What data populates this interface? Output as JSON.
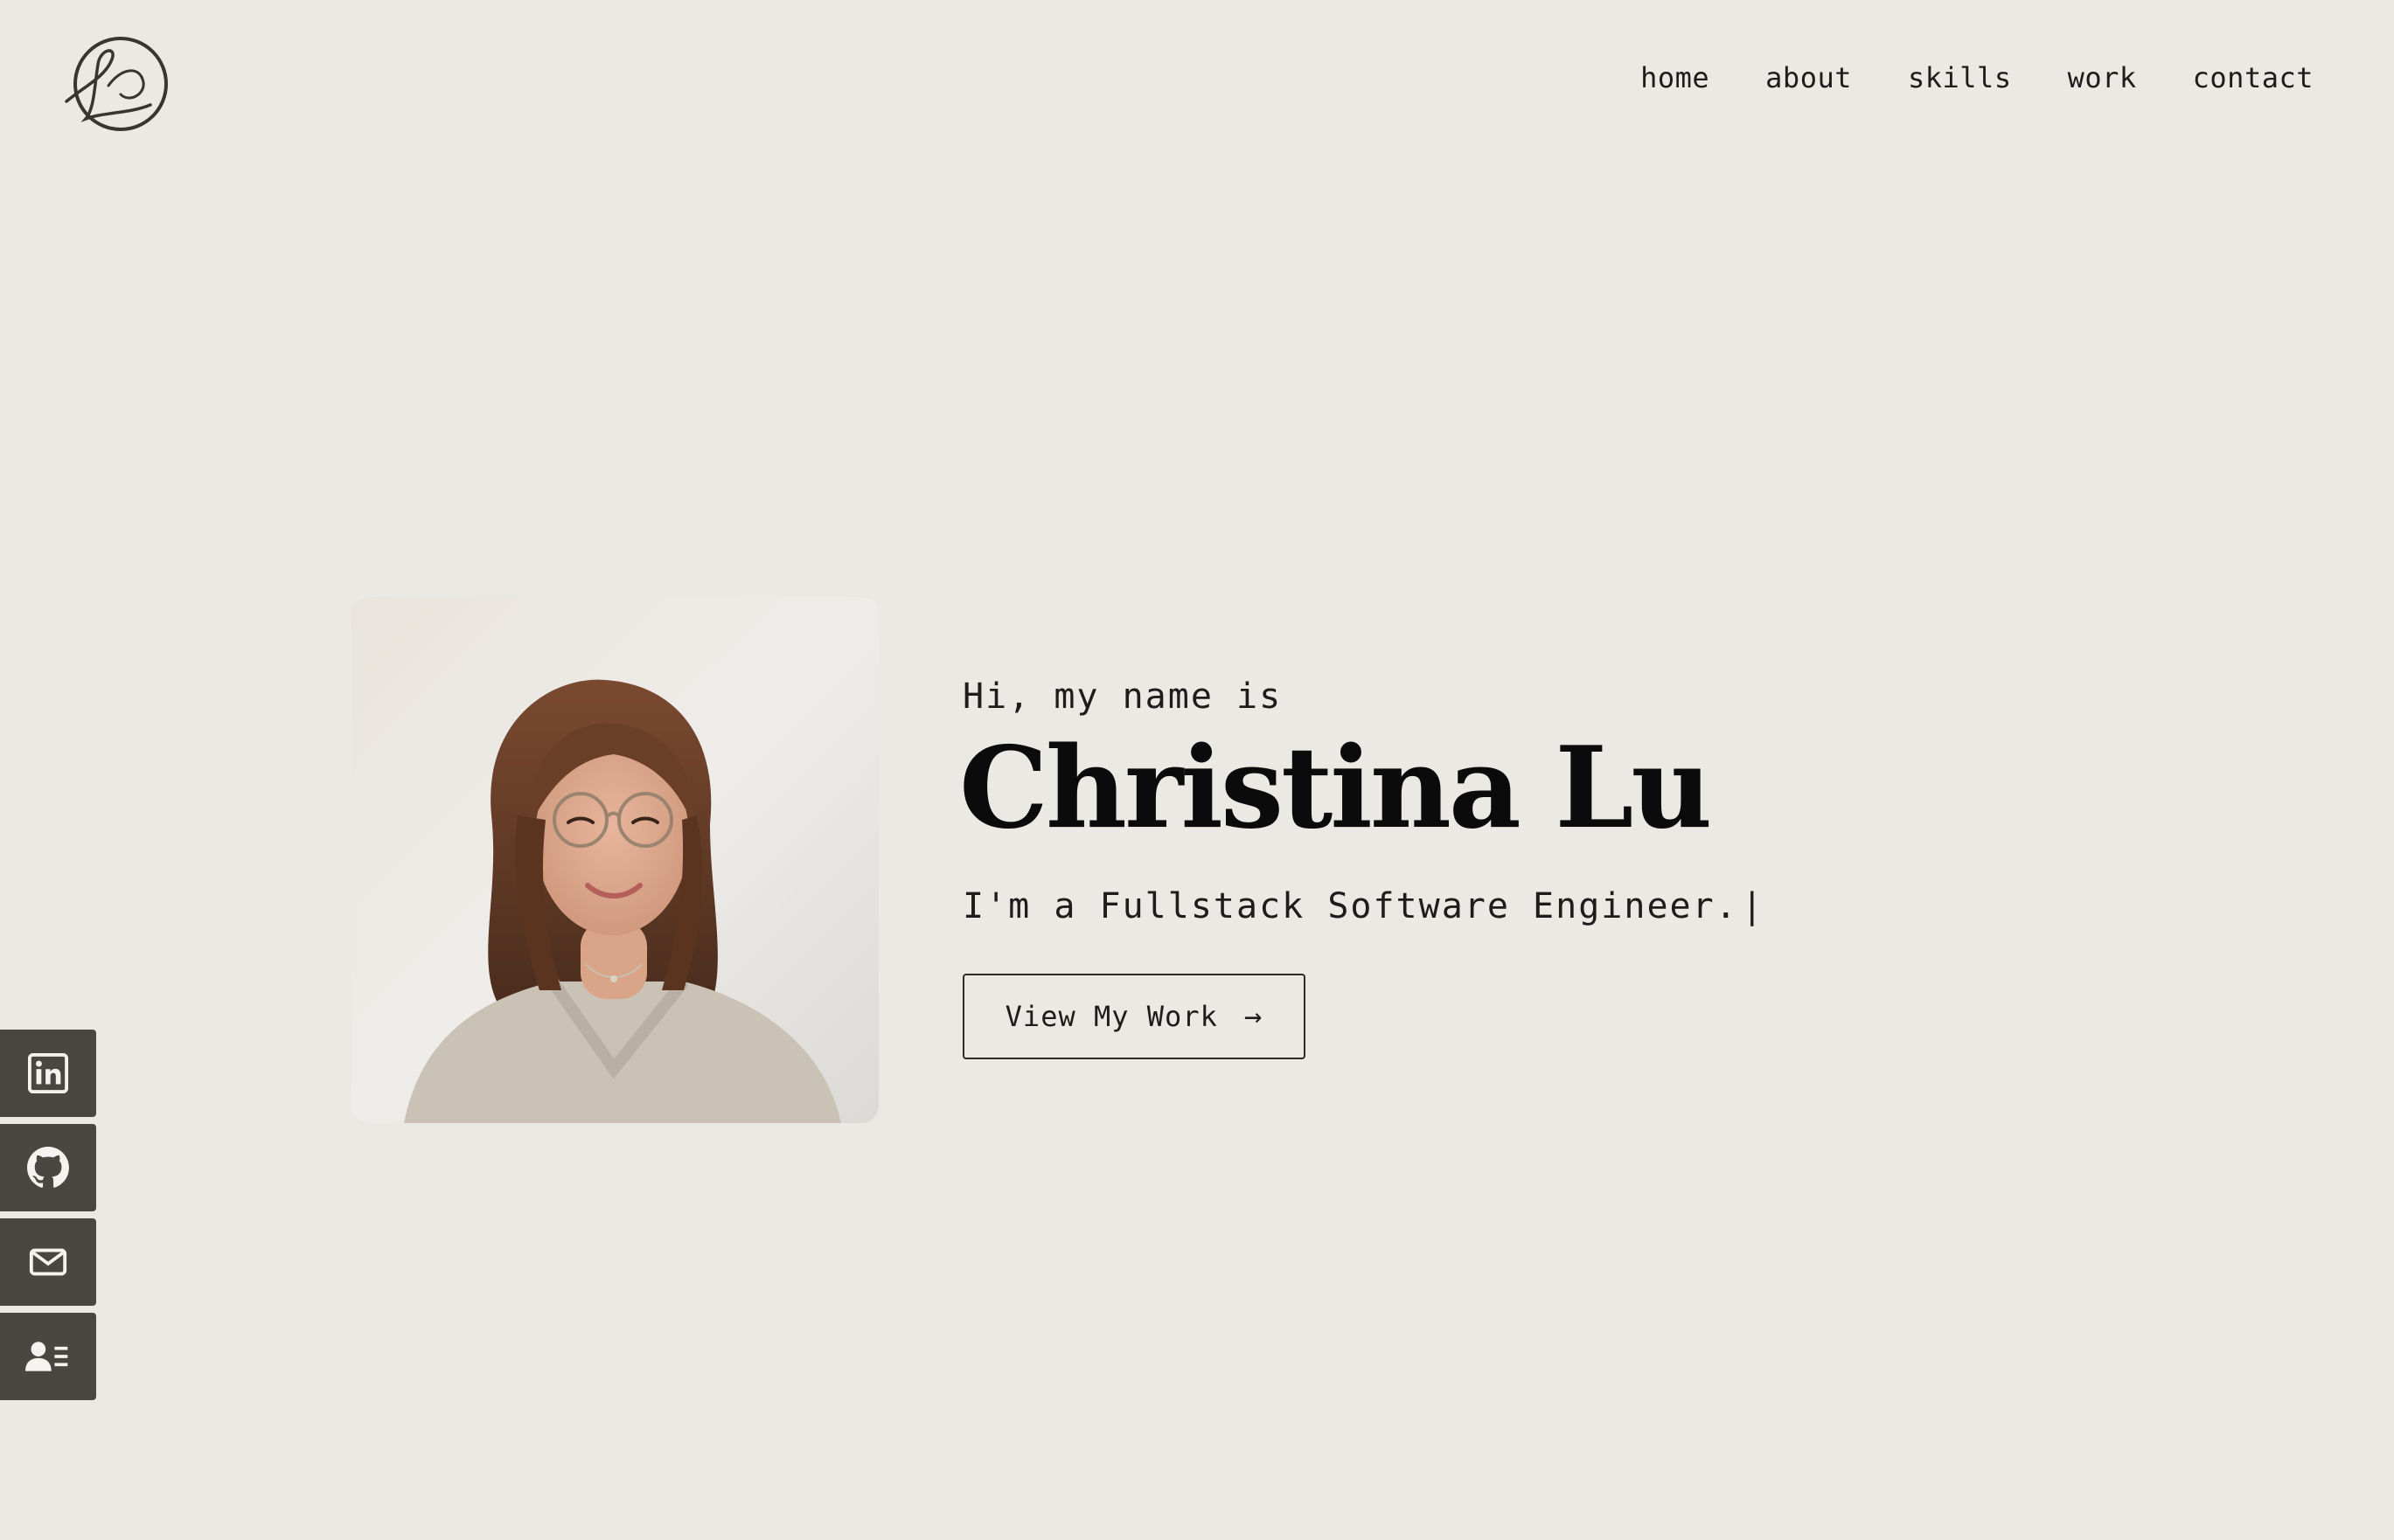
{
  "logo": {
    "icon": "cl-monogram-logo"
  },
  "nav": {
    "items": [
      {
        "label": "home"
      },
      {
        "label": "about"
      },
      {
        "label": "skills"
      },
      {
        "label": "work"
      },
      {
        "label": "contact"
      }
    ]
  },
  "hero": {
    "intro": "Hi, my name is",
    "name": "Christina Lu",
    "tagline": "I'm a Fullstack Software Engineer.",
    "cursor": "|",
    "cta_label": "View My Work",
    "cta_arrow": "→"
  },
  "social": {
    "items": [
      {
        "icon": "linkedin-icon"
      },
      {
        "icon": "github-icon"
      },
      {
        "icon": "mail-icon"
      },
      {
        "icon": "resume-contact-icon"
      }
    ]
  },
  "colors": {
    "background": "#ebe9e4",
    "text": "#1f1d1b",
    "social_bg": "#4a4642"
  }
}
